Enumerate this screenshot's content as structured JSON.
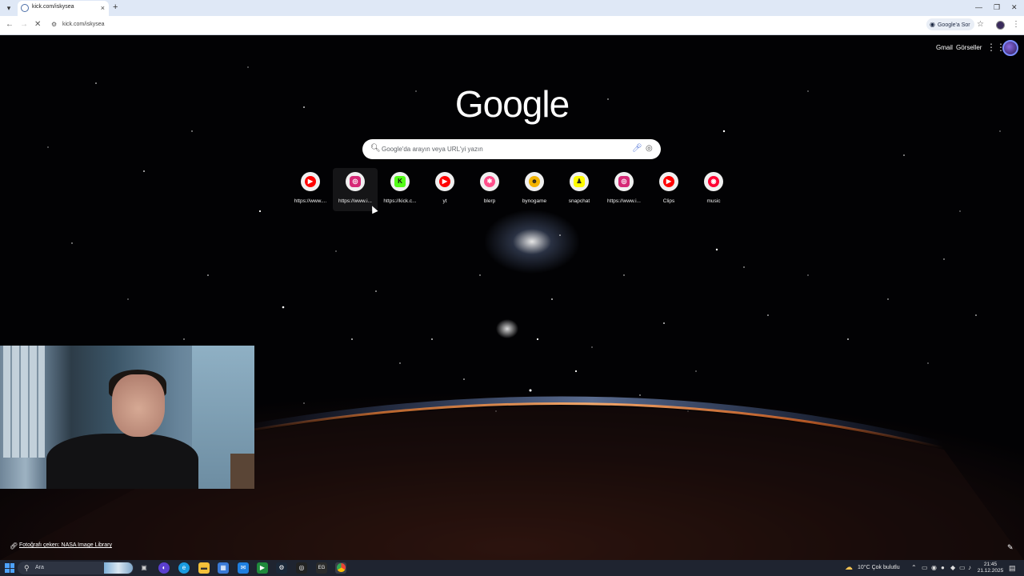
{
  "browser": {
    "tab_title": "kick.com/iskysea",
    "new_tab_symbol": "+",
    "close_symbol": "×",
    "url": "kick.com/iskysea",
    "lens_chip_label": "Google'a Sor"
  },
  "page": {
    "header_links": [
      "Gmail",
      "Görseller"
    ],
    "logo": "Google",
    "search_placeholder": "Google'da arayın veya URL'yi yazın",
    "shortcuts": [
      {
        "label": "https://www....",
        "icon": "youtube-icon",
        "color": "#ff0000"
      },
      {
        "label": "https://www.i...",
        "icon": "instagram-icon",
        "color": "#d62976"
      },
      {
        "label": "https://kick.c...",
        "icon": "kick-icon",
        "color": "#53fc18"
      },
      {
        "label": "yt",
        "icon": "youtube-icon",
        "color": "#ff0000"
      },
      {
        "label": "blerp",
        "icon": "blerp-icon",
        "color": "#ff4f8b"
      },
      {
        "label": "bynogame",
        "icon": "bynogame-icon",
        "color": "#f4b400"
      },
      {
        "label": "snapchat",
        "icon": "snapchat-icon",
        "color": "#fffc00"
      },
      {
        "label": "https://www.i...",
        "icon": "instagram-icon",
        "color": "#d62976"
      },
      {
        "label": "Clips",
        "icon": "youtube-icon",
        "color": "#ff0000"
      },
      {
        "label": "music",
        "icon": "music-icon",
        "color": "#ff0033"
      }
    ],
    "photo_credit": "Fotoğrafı çeken: NASA Image Library"
  },
  "taskbar": {
    "search_label": "Ara",
    "weather": "10°C  Çok bulutlu",
    "time": "21:45",
    "date": "21.12.2025"
  }
}
